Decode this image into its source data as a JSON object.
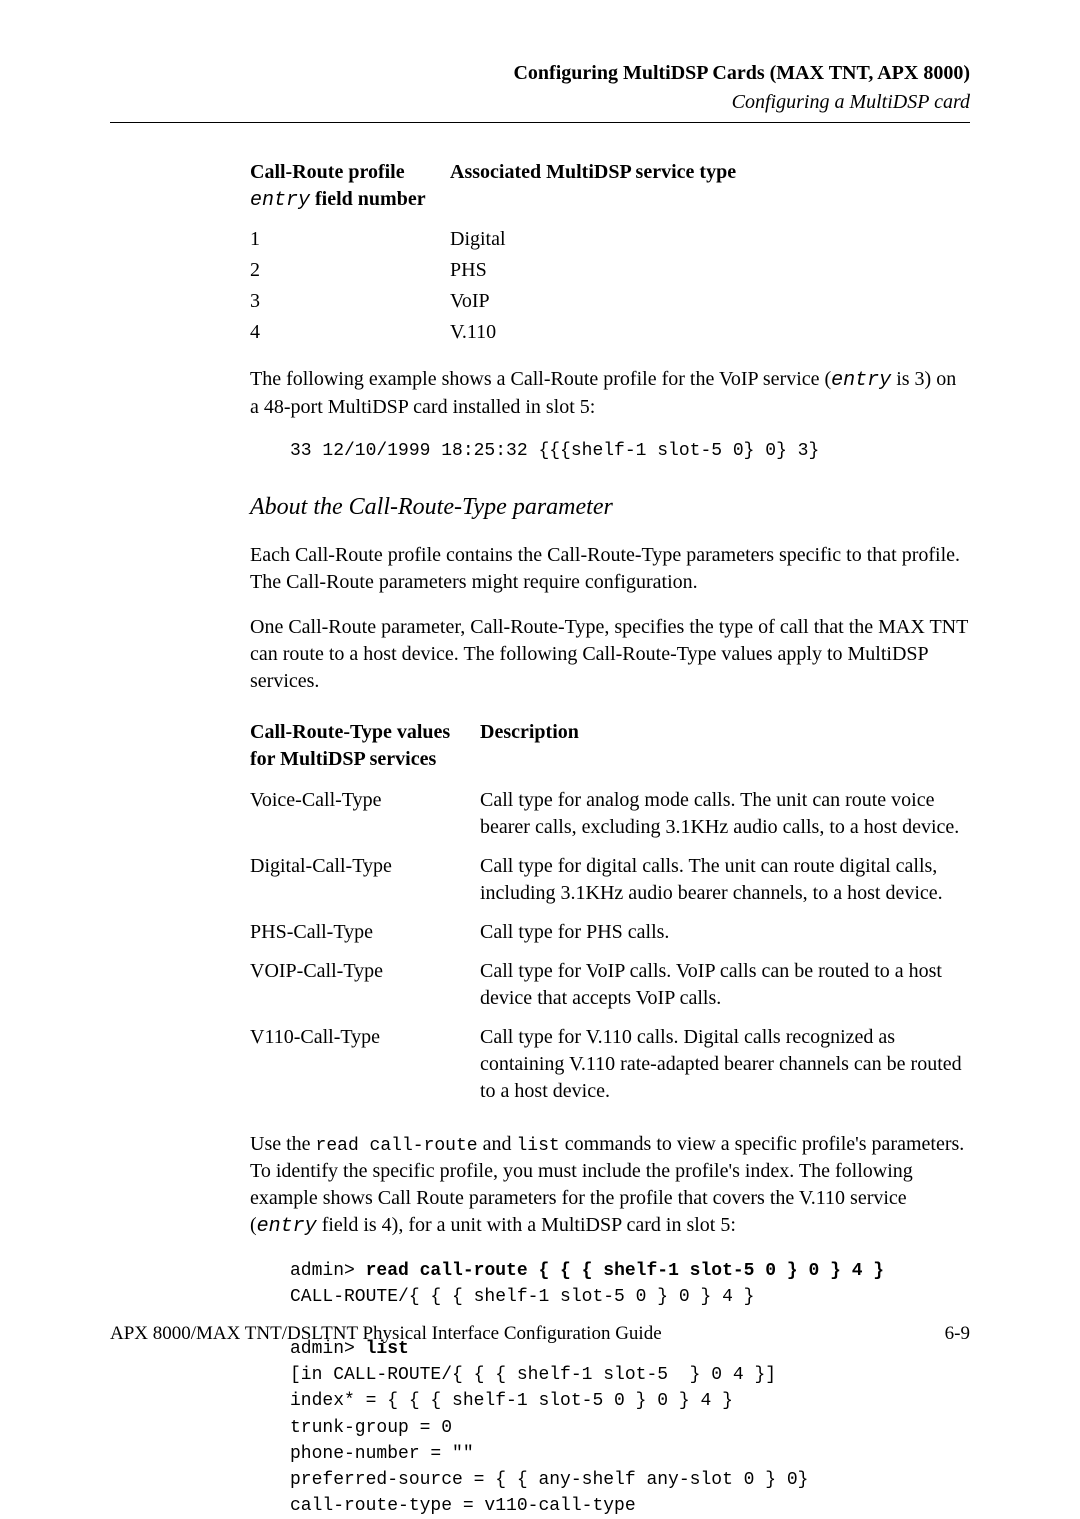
{
  "header": {
    "title_bold": "Configuring MultiDSP Cards (MAX TNT, APX 8000)",
    "subtitle_italic": "Configuring a MultiDSP card"
  },
  "table1": {
    "head_c1_line1": "Call-Route profile",
    "head_c1_mono": "entry",
    "head_c1_line2_suffix": " field number",
    "head_c2": "Associated MultiDSP service type",
    "rows": [
      {
        "num": "1",
        "svc": "Digital"
      },
      {
        "num": "2",
        "svc": "PHS"
      },
      {
        "num": "3",
        "svc": "VoIP"
      },
      {
        "num": "4",
        "svc": "V.110"
      }
    ]
  },
  "para1_a": "The following example shows a Call-Route profile for the VoIP service (",
  "para1_mono": "entry",
  "para1_b": " is 3) on a 48-port MultiDSP card installed in slot 5:",
  "code1": "33 12/10/1999 18:25:32 {{{shelf-1 slot-5 0} 0} 3}",
  "subhead": "About the Call-Route-Type parameter",
  "para2": "Each Call-Route profile contains the Call-Route-Type parameters specific to that profile. The Call-Route parameters might require configuration.",
  "para3": "One Call-Route parameter, Call-Route-Type, specifies the type of call that the MAX TNT can route to a host device. The following Call-Route-Type values apply to MultiDSP services.",
  "table2": {
    "head_c1": "Call-Route-Type values for MultiDSP services",
    "head_c2": "Description",
    "rows": [
      {
        "v": "Voice-Call-Type",
        "d": "Call type for analog mode calls. The unit can route voice bearer calls, excluding 3.1KHz audio calls, to a host device."
      },
      {
        "v": "Digital-Call-Type",
        "d": "Call type for digital calls. The unit can route digital calls, including 3.1KHz audio bearer channels, to a host device."
      },
      {
        "v": "PHS-Call-Type",
        "d": "Call type for PHS calls."
      },
      {
        "v": "VOIP-Call-Type",
        "d": "Call type for VoIP calls. VoIP calls can be routed to a host device that accepts VoIP calls."
      },
      {
        "v": "V110-Call-Type",
        "d": "Call type for V.110 calls. Digital calls recognized as containing V.110 rate-adapted bearer channels can be routed to a host device."
      }
    ]
  },
  "para4_a": "Use the ",
  "para4_m1": "read call-route",
  "para4_b": " and ",
  "para4_m2": "list",
  "para4_c": " commands to view a specific profile's parameters. To identify the specific profile, you must include the profile's index. The following example shows Call Route parameters for the profile that covers the V.110 service (",
  "para4_m3": "entry",
  "para4_d": " field is 4), for a unit with a MultiDSP card in slot 5:",
  "code2": {
    "l1a": "admin> ",
    "l1b": "read call-route { { { shelf-1 slot-5 0 } 0 } 4 }",
    "l2": "CALL-ROUTE/{ { { shelf-1 slot-5 0 } 0 } 4 }",
    "l3": "",
    "l4a": "admin> ",
    "l4b": "list",
    "l5": "[in CALL-ROUTE/{ { { shelf-1 slot-5  } 0 4 }]",
    "l6": "index* = { { { shelf-1 slot-5 0 } 0 } 4 }",
    "l7": "trunk-group = 0",
    "l8": "phone-number = \"\"",
    "l9": "preferred-source = { { any-shelf any-slot 0 } 0}",
    "l10": "call-route-type = v110-call-type"
  },
  "footer": {
    "left": "APX 8000/MAX TNT/DSLTNT Physical Interface Configuration Guide",
    "right": "6-9"
  }
}
